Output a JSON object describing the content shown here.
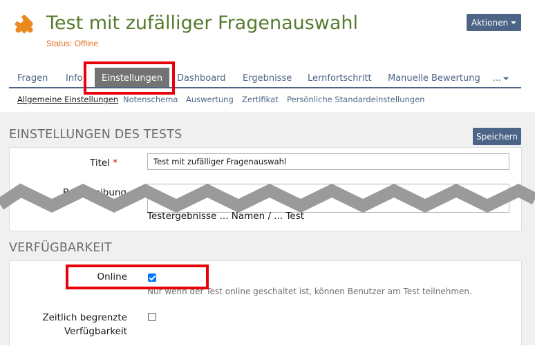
{
  "header": {
    "icon": "puzzle-piece-icon",
    "title": "Test mit zufälliger Fragenauswahl",
    "status": "Status: Offline",
    "actions_label": "Aktionen"
  },
  "tabs": [
    {
      "label": "Fragen"
    },
    {
      "label": "Info"
    },
    {
      "label": "Einstellungen",
      "active": true
    },
    {
      "label": "Dashboard"
    },
    {
      "label": "Ergebnisse"
    },
    {
      "label": "Lernfortschritt"
    },
    {
      "label": "Manuelle Bewertung"
    }
  ],
  "more_label": "...",
  "subtabs": [
    {
      "label": "Allgemeine Einstellungen",
      "active": true
    },
    {
      "label": "Notenschema"
    },
    {
      "label": "Auswertung"
    },
    {
      "label": "Zertifikat"
    },
    {
      "label": "Persönliche Standardeinstellungen"
    }
  ],
  "settings": {
    "section_title": "EINSTELLUNGEN DES TESTS",
    "save_label": "Speichern",
    "title_label": "Titel",
    "required_mark": "*",
    "title_value": "Test mit zufälliger Fragenauswahl",
    "description_label": "Beschreibung",
    "partial_text": "Testergebnisse ... Namen / ... Test"
  },
  "availability": {
    "section_title": "VERFÜGBARKEIT",
    "online_label": "Online",
    "online_checked": true,
    "online_help": "Nur wenn der Test online geschaltet ist, können Benutzer am Test teilnehmen.",
    "limited_label_line1": "Zeitlich begrenzte",
    "limited_label_line2": "Verfügbarkeit",
    "limited_checked": false
  },
  "colors": {
    "accent": "#4c6586",
    "title_green": "#557b2e",
    "status_orange": "#e36f23",
    "highlight_red": "#e8000b"
  }
}
